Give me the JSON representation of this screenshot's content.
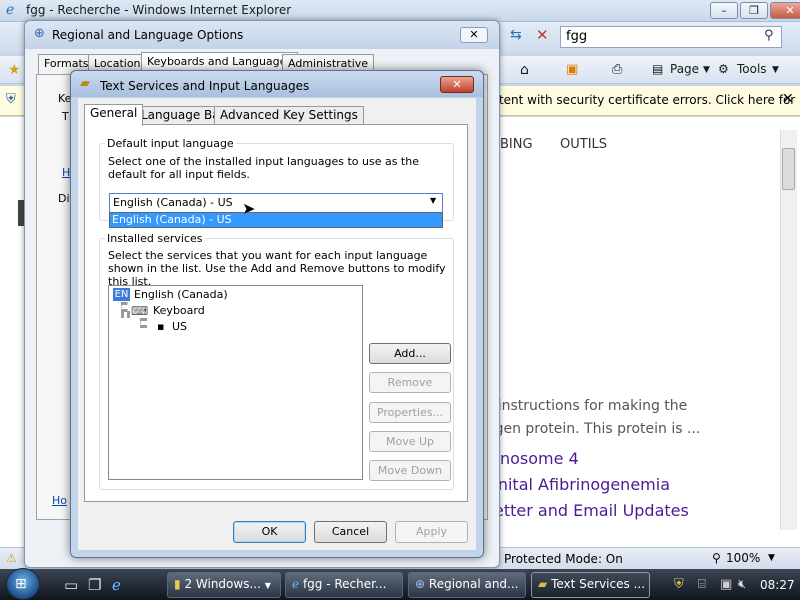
{
  "ie": {
    "title": "fgg - Recherche - Windows Internet Explorer",
    "search_value": "fgg",
    "cmd_page": "Page",
    "cmd_tools": "Tools",
    "infobar_text": "ontent with security certificate errors. Click here for",
    "nav_bing": "BING",
    "nav_outils": "OUTILS",
    "content_line1": "s instructions for making the",
    "content_line2": "ogen protein. This protein is ...",
    "link1": "nosome 4",
    "link2": "enital Afibrinogenemia",
    "link3": "etter and Email Updates",
    "protected_mode": "Protected Mode: On",
    "zoom": "100%"
  },
  "regional": {
    "title": "Regional and Language Options",
    "tabs": [
      "Formats",
      "Location",
      "Keyboards and Languages",
      "Administrative"
    ],
    "partial_labels": [
      "Ke",
      "T",
      "H",
      "Di",
      "Ho"
    ]
  },
  "text_services": {
    "title": "Text Services and Input Languages",
    "tabs": [
      "General",
      "Language Bar",
      "Advanced Key Settings"
    ],
    "default_group_label": "Default input language",
    "default_desc": "Select one of the installed input languages to use as the default for all input fields.",
    "selected_language": "English (Canada) - US",
    "dropdown_options": [
      "English (Canada) - US"
    ],
    "installed_group_label": "Installed services",
    "installed_desc": "Select the services that you want for each input language shown in the list. Use the Add and Remove buttons to modify this list.",
    "tree": {
      "badge": "EN",
      "language": "English (Canada)",
      "keyboard": "Keyboard",
      "layout": "US"
    },
    "buttons": {
      "add": "Add...",
      "remove": "Remove",
      "properties": "Properties...",
      "move_up": "Move Up",
      "move_down": "Move Down",
      "ok": "OK",
      "cancel": "Cancel",
      "apply": "Apply"
    }
  },
  "taskbar": {
    "tasks": [
      "2 Windows...",
      "fgg - Recher...",
      "Regional and...",
      "Text Services ..."
    ],
    "clock": "08:27"
  }
}
